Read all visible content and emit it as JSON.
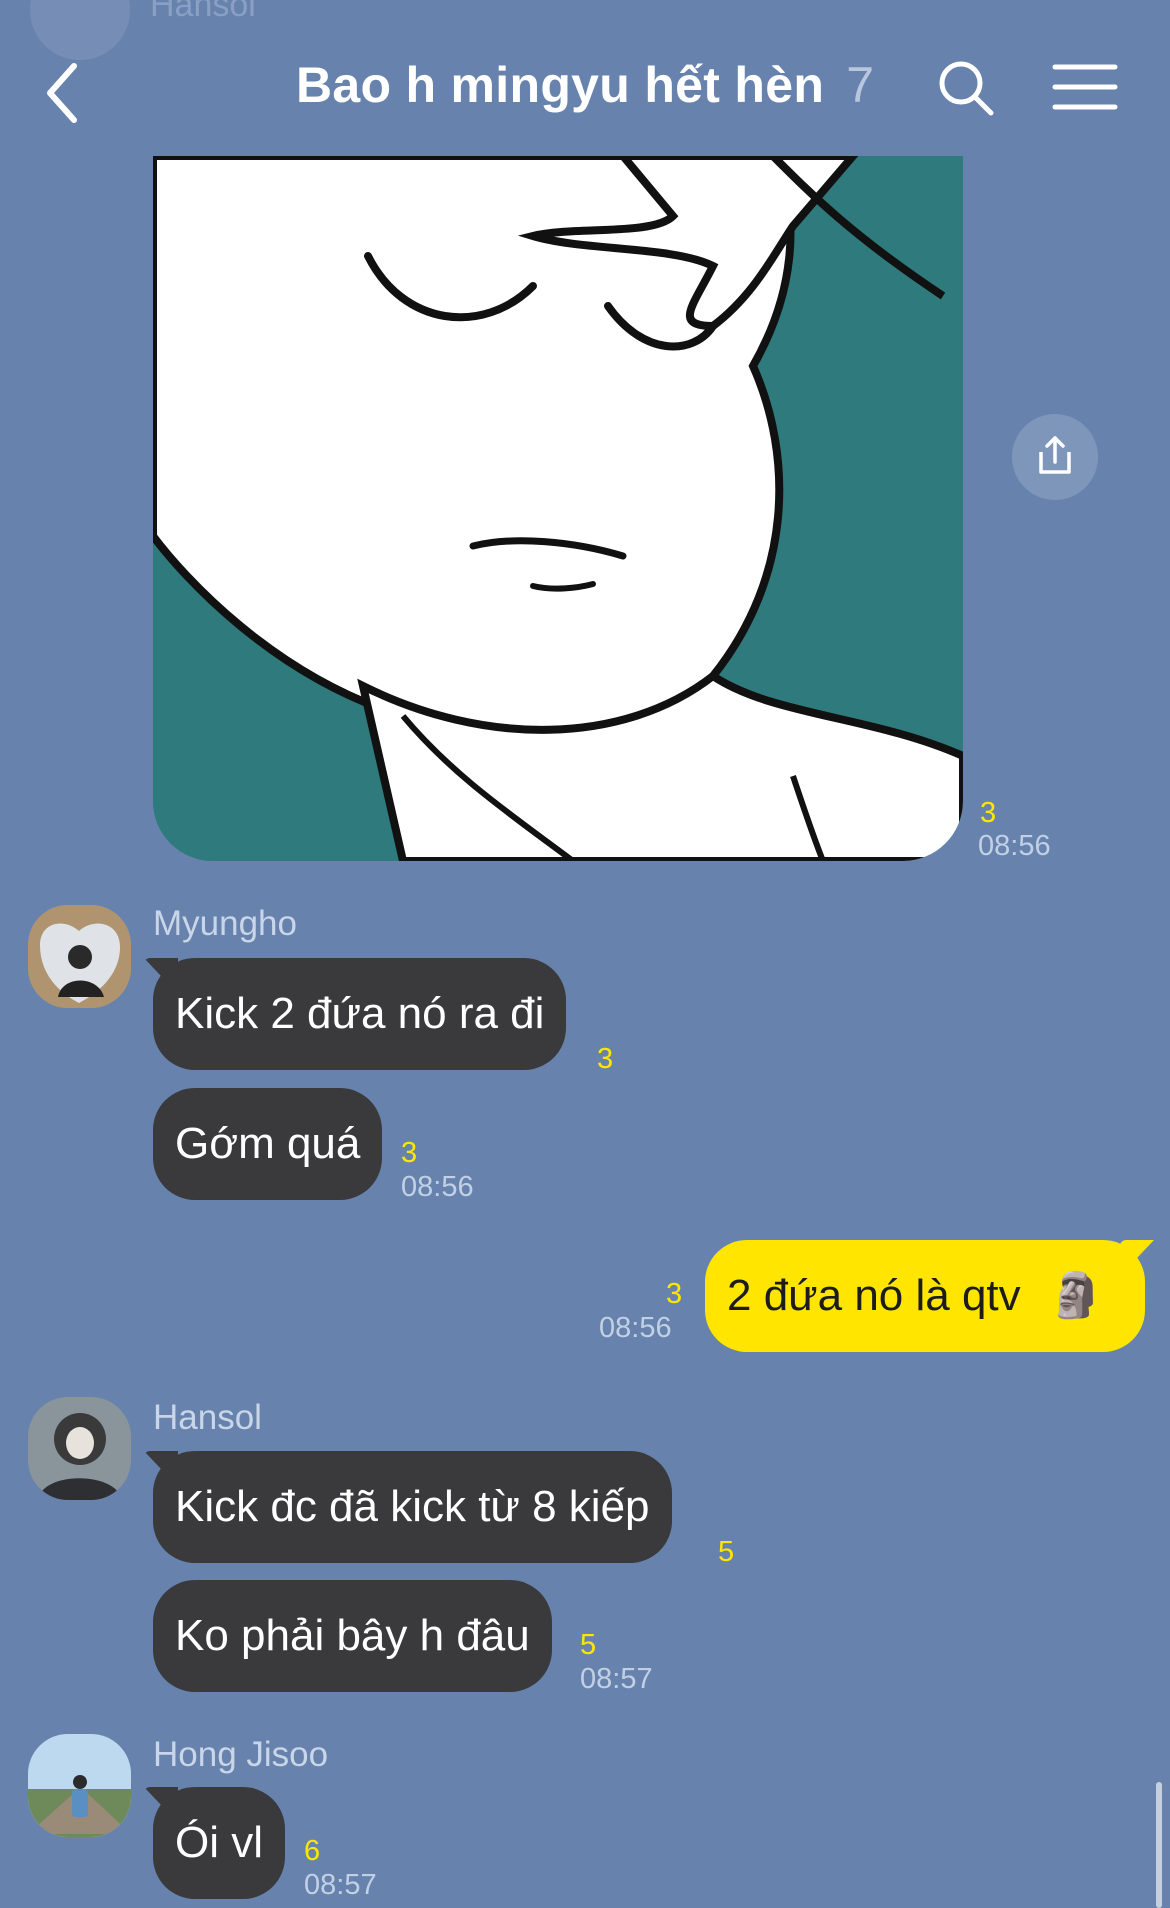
{
  "header": {
    "ghost_sender": "Hansol",
    "title": "Bao h mingyu hết hèn",
    "member_count": "7"
  },
  "colors": {
    "background": "#6783ad",
    "bubble_other": "#3a3a3c",
    "bubble_mine": "#ffe500",
    "read_count": "#ffe600"
  },
  "icons": {
    "back": "chevron-left-icon",
    "search": "search-icon",
    "menu": "hamburger-menu-icon",
    "share": "share-upload-icon",
    "emoji": "moai-emoji"
  },
  "image_message": {
    "read_count": "3",
    "time": "08:56"
  },
  "messages": [
    {
      "sender": "Myungho",
      "bubbles": [
        {
          "text": "Kick 2 đứa nó ra đi",
          "read_count": "3",
          "time": ""
        },
        {
          "text": "Gớm quá",
          "read_count": "3",
          "time": "08:56"
        }
      ]
    },
    {
      "sender": "me",
      "bubbles": [
        {
          "text": "2 đứa nó là qtv",
          "emoji": "🗿",
          "read_count": "3",
          "time": "08:56"
        }
      ]
    },
    {
      "sender": "Hansol",
      "bubbles": [
        {
          "text": "Kick đc đã kick từ 8 kiếp",
          "read_count": "5",
          "time": ""
        },
        {
          "text": "Ko phải bây h đâu",
          "read_count": "5",
          "time": "08:57"
        }
      ]
    },
    {
      "sender": "Hong Jisoo",
      "bubbles": [
        {
          "text": "Ói vl",
          "read_count": "6",
          "time": "08:57"
        }
      ]
    }
  ]
}
